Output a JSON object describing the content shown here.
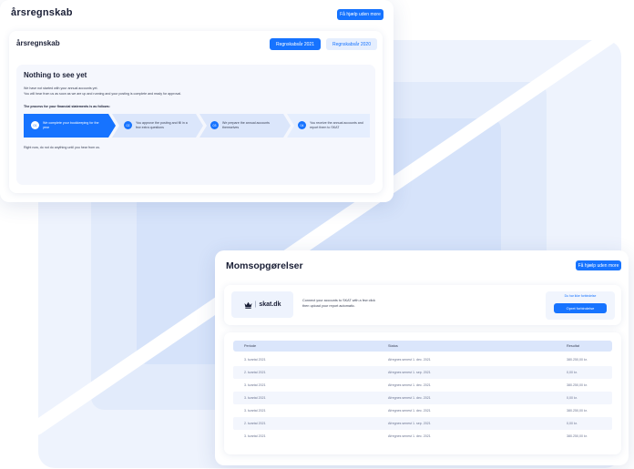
{
  "colors": {
    "accent": "#1673ff",
    "light": "#e5eefe"
  },
  "card1": {
    "title": "årsregnskab",
    "help_button": "Få hjælp uden more",
    "inner_title": "årsregnskab",
    "tabs": [
      {
        "label": "Regnskabsår 2021"
      },
      {
        "label": "Regnskabsår 2020"
      }
    ],
    "panel": {
      "heading": "Nothing to see yet",
      "line1": "We have not started with your annual accounts yet.",
      "line2": "You will hear from us as soon as we are up and running and your posting is complete and ready for approval.",
      "process_label": "The process for your financial statements is as follows:",
      "steps": [
        {
          "num": "01",
          "text": "We complete your bookkeeping for the year"
        },
        {
          "num": "02",
          "text": "You approve the posting and fill in a few extra questions"
        },
        {
          "num": "03",
          "text": "We prepare the annual accounts themselves"
        },
        {
          "num": "04",
          "text": "You receive the annual accounts and report them to SKAT"
        }
      ],
      "footer": "Right now, do not do anything until you hear from us."
    }
  },
  "card2": {
    "title": "Momsopgørelser",
    "help_button": "Få hjælp uden more",
    "skat": {
      "logo_icon": "crown-icon",
      "logo_text": "skat.dk",
      "text_line1": "Connect your accounts to SKAT with a few click",
      "text_line2": "then upload your report automatic.",
      "note": "Du har ikke forbindelse",
      "button": "Opret forbindelse"
    },
    "table": {
      "headers": [
        "Periode",
        "Status",
        "Resultat"
      ],
      "rows": [
        [
          "3. kvartal 2021",
          "Afregnes senest 1. dec. 2021",
          "380.250,00 kr."
        ],
        [
          "2. kvartal 2021",
          "Afregnes senest 1. sep. 2021",
          "0,00 kr."
        ],
        [
          "3. kvartal 2021",
          "Afregnes senest 1. dec. 2021",
          "380.250,00 kr."
        ],
        [
          "3. kvartal 2021",
          "Afregnes senest 1. dec. 2021",
          "0,00 kr."
        ],
        [
          "3. kvartal 2021",
          "Afregnes senest 1. dec. 2021",
          "380.250,00 kr."
        ],
        [
          "2. kvartal 2021",
          "Afregnes senest 1. sep. 2021",
          "0,00 kr."
        ],
        [
          "3. kvartal 2021",
          "Afregnes senest 1. dec. 2021",
          "380.250,00 kr."
        ]
      ]
    }
  }
}
